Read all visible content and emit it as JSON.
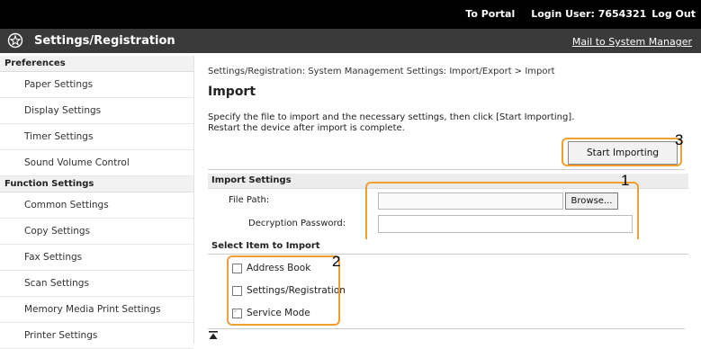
{
  "topbar": {
    "portal_link": "To Portal",
    "login_user": "Login User:  7654321",
    "logout_link": "Log Out"
  },
  "header": {
    "logo_icon": "settings-gear-icon",
    "title": "Settings/Registration",
    "mail_link": "Mail to System Manager"
  },
  "sidebar": {
    "preferences_heading": "Preferences",
    "preferences_items": [
      "Paper Settings",
      "Display Settings",
      "Timer Settings",
      "Sound Volume Control"
    ],
    "function_heading": "Function Settings",
    "function_items": [
      "Common Settings",
      "Copy Settings",
      "Fax Settings",
      "Scan Settings",
      "Memory Media Print Settings",
      "Printer Settings"
    ]
  },
  "main": {
    "breadcrumb": "Settings/Registration: System Management Settings: Import/Export > Import",
    "title": "Import",
    "desc_line1": "Specify the file to import and the necessary settings, then click [Start Importing].",
    "desc_line2": "Restart the device after import is complete.",
    "start_button": "Start Importing",
    "import_settings": {
      "heading": "Import Settings",
      "file_path_label": "File Path:",
      "file_path_value": "",
      "browse_button": "Browse...",
      "password_label": "Decryption Password:",
      "password_value": ""
    },
    "select_items": {
      "heading": "Select Item to Import",
      "items": [
        {
          "label": "Address Book",
          "checked": false,
          "enabled": true
        },
        {
          "label": "Settings/Registration",
          "checked": false,
          "enabled": true
        },
        {
          "label": "Service Mode",
          "checked": true,
          "enabled": false
        }
      ]
    },
    "callouts": [
      "1",
      "2",
      "3"
    ],
    "callout_color": "#f0a030"
  }
}
